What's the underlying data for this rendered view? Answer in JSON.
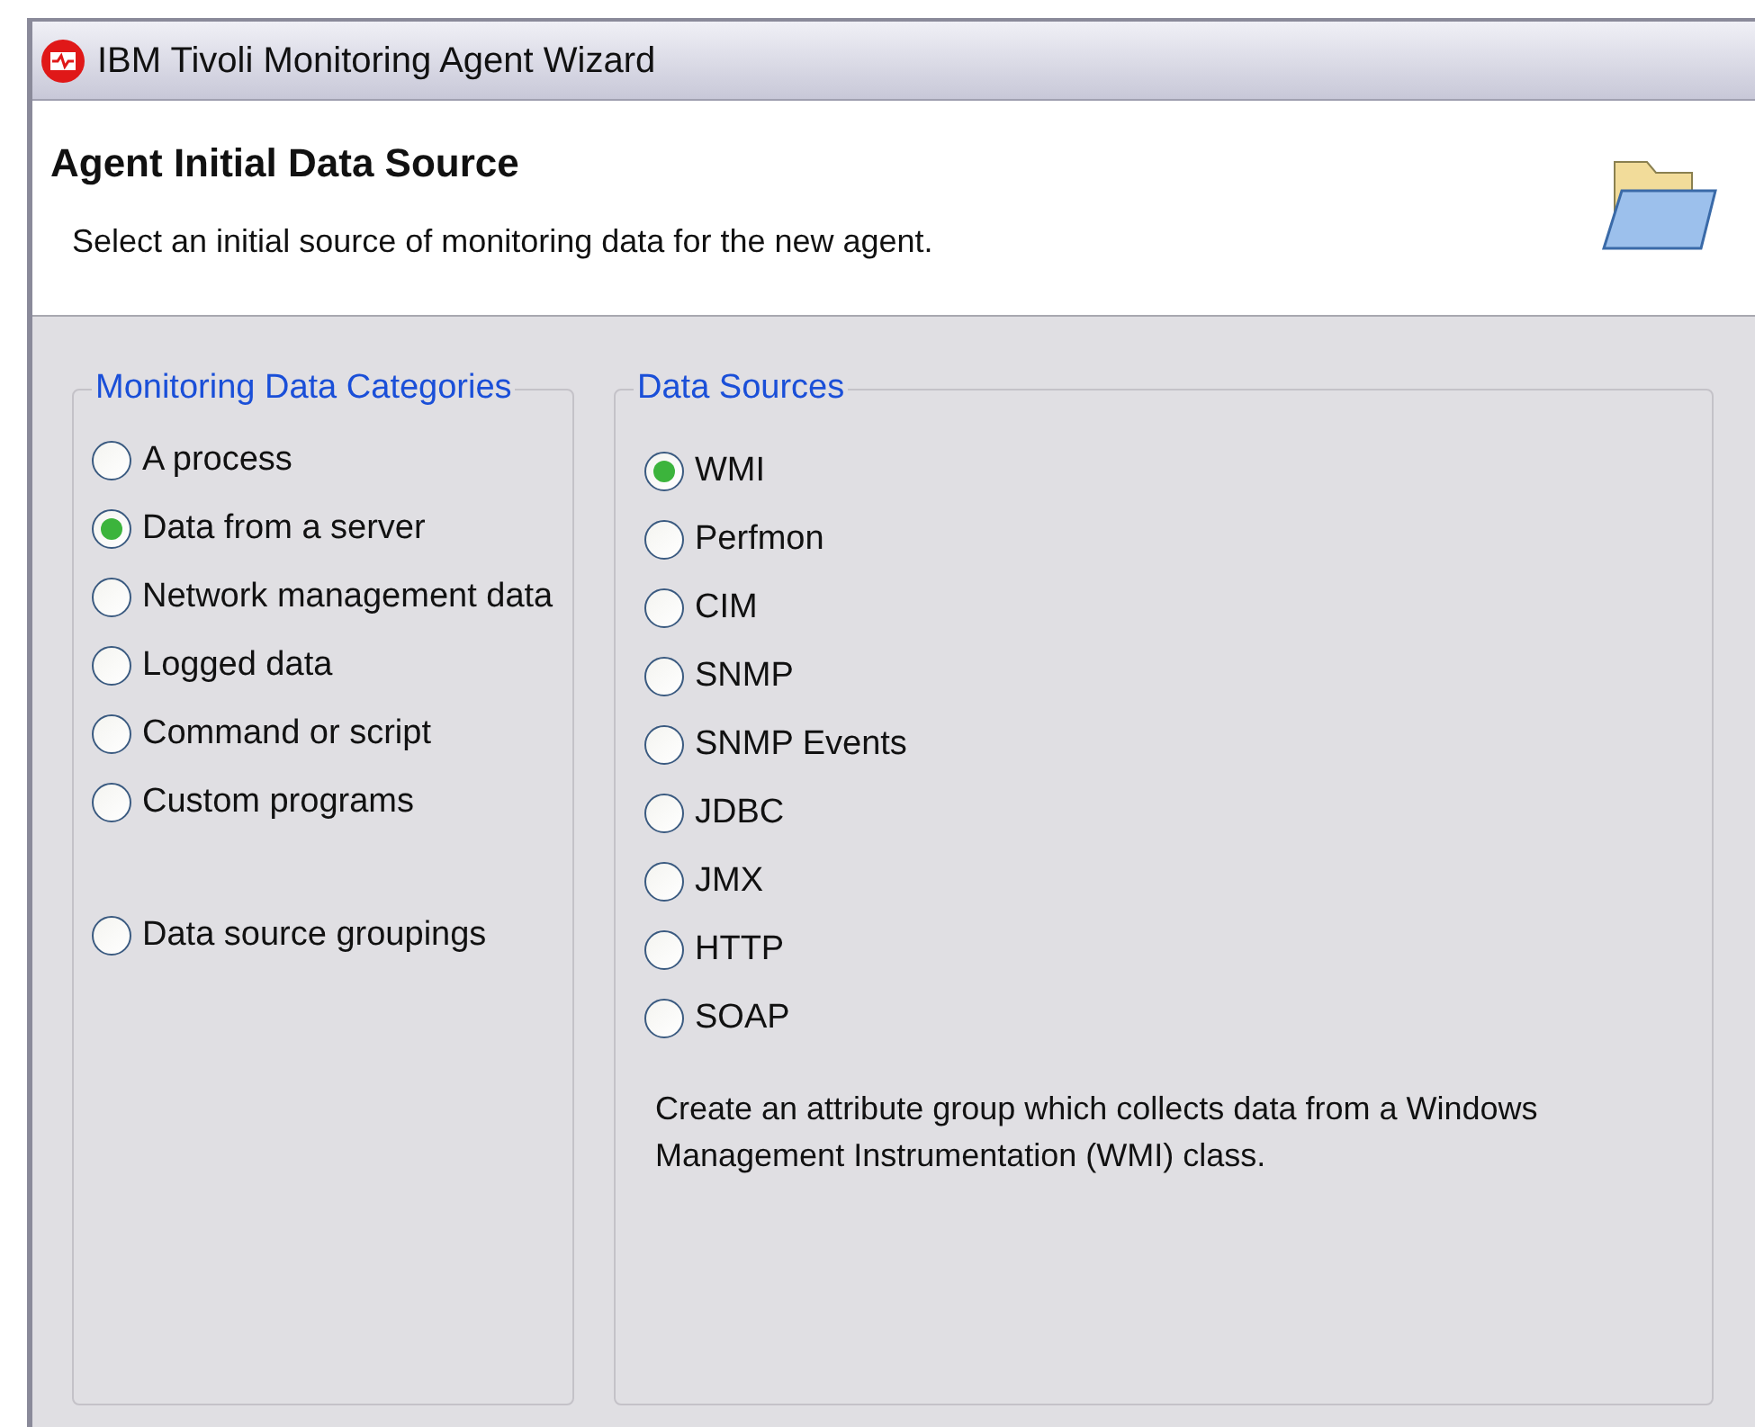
{
  "window": {
    "title": "IBM Tivoli Monitoring Agent Wizard"
  },
  "header": {
    "title": "Agent Initial Data Source",
    "description": "Select an initial source of monitoring data for the new agent."
  },
  "categories": {
    "title": "Monitoring Data Categories",
    "options": [
      {
        "label": "A process",
        "selected": false,
        "kind": "option"
      },
      {
        "label": "Data from a server",
        "selected": true,
        "kind": "option"
      },
      {
        "label": "Network management data",
        "selected": false,
        "kind": "option"
      },
      {
        "label": "Logged data",
        "selected": false,
        "kind": "option"
      },
      {
        "label": "Command or script",
        "selected": false,
        "kind": "option"
      },
      {
        "label": "Custom programs",
        "selected": false,
        "kind": "option"
      },
      {
        "label": "Data source groupings",
        "selected": false,
        "kind": "grouping"
      }
    ]
  },
  "sources": {
    "title": "Data Sources",
    "options": [
      {
        "label": "WMI",
        "selected": true
      },
      {
        "label": "Perfmon",
        "selected": false
      },
      {
        "label": "CIM",
        "selected": false
      },
      {
        "label": "SNMP",
        "selected": false
      },
      {
        "label": "SNMP Events",
        "selected": false
      },
      {
        "label": "JDBC",
        "selected": false
      },
      {
        "label": "JMX",
        "selected": false
      },
      {
        "label": "HTTP",
        "selected": false
      },
      {
        "label": "SOAP",
        "selected": false
      }
    ],
    "description": "Create an attribute group which collects data from a Windows Management Instrumentation (WMI) class."
  }
}
